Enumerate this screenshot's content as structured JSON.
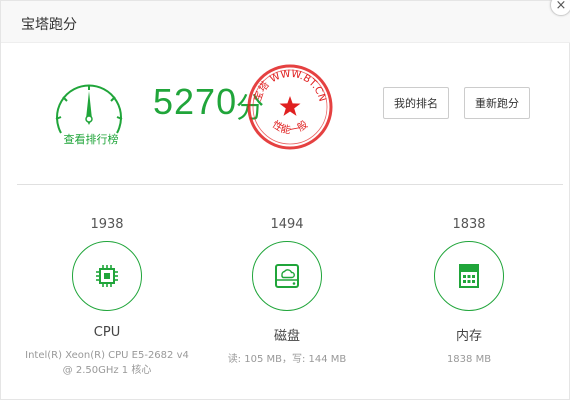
{
  "dialog": {
    "title": "宝塔跑分",
    "close_label": "×"
  },
  "score": {
    "value": "5270",
    "unit": "分",
    "view_rank_label": "查看排行榜"
  },
  "stamp": {
    "top_text": "宝塔 WWW.BT.CN",
    "bottom_text": "性能一般",
    "color": "#e02020"
  },
  "actions": {
    "my_rank_label": "我的排名",
    "retest_label": "重新跑分"
  },
  "metrics": [
    {
      "value": "1938",
      "name": "CPU",
      "detail": "Intel(R) Xeon(R) CPU E5-2682 v4 @ 2.50GHz 1 核心",
      "icon": "cpu-chip-icon"
    },
    {
      "value": "1494",
      "name": "磁盘",
      "detail": "读: 105 MB，写: 144 MB",
      "icon": "disk-drive-icon"
    },
    {
      "value": "1838",
      "name": "内存",
      "detail": "1838 MB",
      "icon": "memory-icon"
    }
  ],
  "colors": {
    "accent": "#20a53a",
    "stamp": "#e02020"
  }
}
